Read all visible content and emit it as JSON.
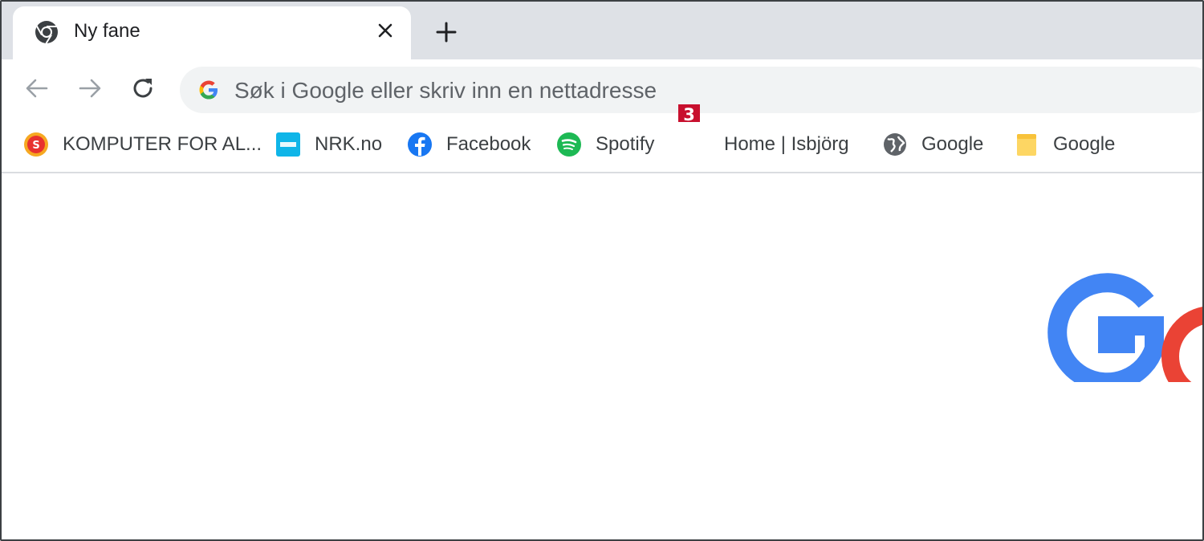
{
  "tab": {
    "title": "Ny fane",
    "favicon": "chrome-icon"
  },
  "toolbar": {
    "back": "arrow-left-icon",
    "forward": "arrow-right-icon",
    "reload": "reload-icon",
    "omnibox_placeholder": "Søk i Google eller skriv inn en nettadresse"
  },
  "marker": "3",
  "bookmarks": [
    {
      "label": "KOMPUTER FOR AL...",
      "icon": "komputer-icon"
    },
    {
      "label": "NRK.no",
      "icon": "nrk-icon"
    },
    {
      "label": "Facebook",
      "icon": "facebook-icon"
    },
    {
      "label": "Spotify",
      "icon": "spotify-icon"
    },
    {
      "label": "Home | Isbjörg",
      "icon": "none"
    },
    {
      "label": "Google",
      "icon": "globe-icon"
    },
    {
      "label": "Google",
      "icon": "folder-icon"
    }
  ],
  "colors": {
    "tabstrip": "#dee1e6",
    "omnibox": "#f1f3f4",
    "marker": "#c8102e",
    "google_blue": "#4285f4",
    "google_red": "#ea4335"
  }
}
